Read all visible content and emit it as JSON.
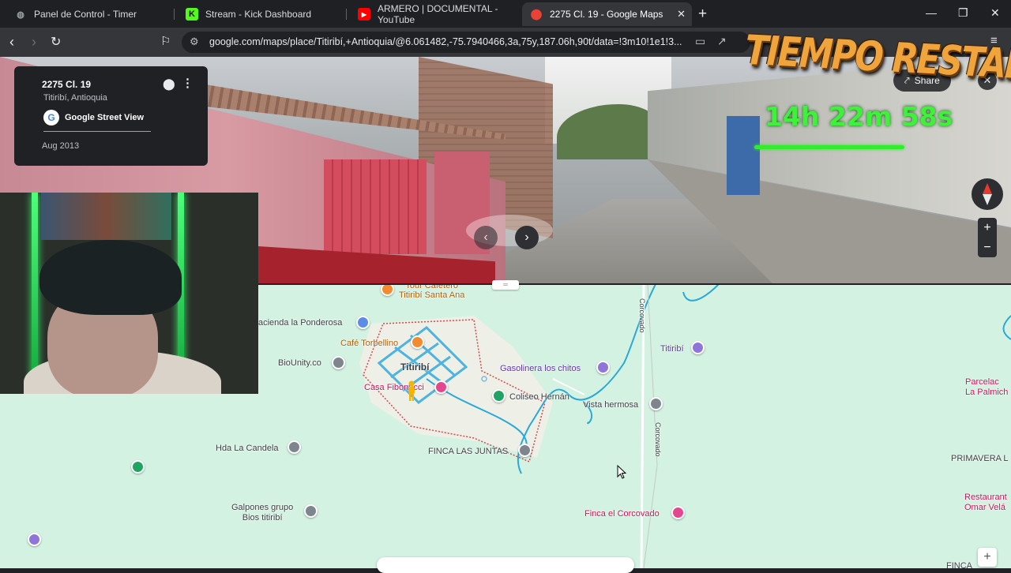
{
  "tabs": [
    {
      "title": "Panel de Control - Timer",
      "icon": "globe-icon",
      "active": false
    },
    {
      "title": "Stream - Kick Dashboard",
      "icon": "kick-icon",
      "active": false
    },
    {
      "title": "ARMERO | DOCUMENTAL - YouTube",
      "icon": "youtube-icon",
      "active": false
    },
    {
      "title": "2275 Cl. 19 - Google Maps",
      "icon": "google-maps-icon",
      "active": true
    }
  ],
  "toolbar": {
    "url": "google.com/maps/place/Titiribí,+Antioquia/@6.061482,-75.7940466,3a,75y,187.06h,90t/data=!3m10!1e1!3..."
  },
  "streetview": {
    "address": "2275 Cl. 19",
    "city": "Titiribí, Antioquia",
    "brand": "Google Street View",
    "date": "Aug 2013",
    "share_label": "Share"
  },
  "overlay": {
    "title": "TIEMPO RESTANTE",
    "time": "14h 22m 58s",
    "progress": 0.73,
    "accent": "#3ef23a"
  },
  "map": {
    "town": "Titiribí",
    "pois": [
      {
        "label": "Tour Cafetero\nTitiribí Santa Ana",
        "kind": "orange"
      },
      {
        "label": "acienda la Ponderosa",
        "kind": "blue"
      },
      {
        "label": "Café Torbellino",
        "kind": "orange"
      },
      {
        "label": "BioUnity.co",
        "kind": "gray"
      },
      {
        "label": "Gasolinera los chitos",
        "kind": "purple"
      },
      {
        "label": "Titiribí",
        "kind": "pink"
      },
      {
        "label": "Casa Fibonacci",
        "kind": "pink"
      },
      {
        "label": "Coliseo Hernán",
        "kind": "green"
      },
      {
        "label": "Vista hermosa",
        "kind": "gray"
      },
      {
        "label": "Hda La Candela",
        "kind": "gray"
      },
      {
        "label": "FINCA LAS JUNTAS",
        "kind": "gray"
      },
      {
        "label": "Galpones grupo\nBios titiribí",
        "kind": "gray"
      },
      {
        "label": "Finca el Corcovado",
        "kind": "pink"
      },
      {
        "label": "PRIMAVERA L",
        "kind": "gray"
      },
      {
        "label": "Parcelac\nLa Palmich",
        "kind": "pink"
      },
      {
        "label": "Restaurant\nOmar Velá",
        "kind": "pink"
      },
      {
        "label": "FINCA",
        "kind": "gray"
      }
    ],
    "road_labels": [
      "Corcovado",
      "Corcovado"
    ],
    "colors": {
      "land": "#d3f2e2",
      "river": "#2aa8d8",
      "town": "#f1efe9",
      "boundary": "#d14b4b"
    }
  }
}
